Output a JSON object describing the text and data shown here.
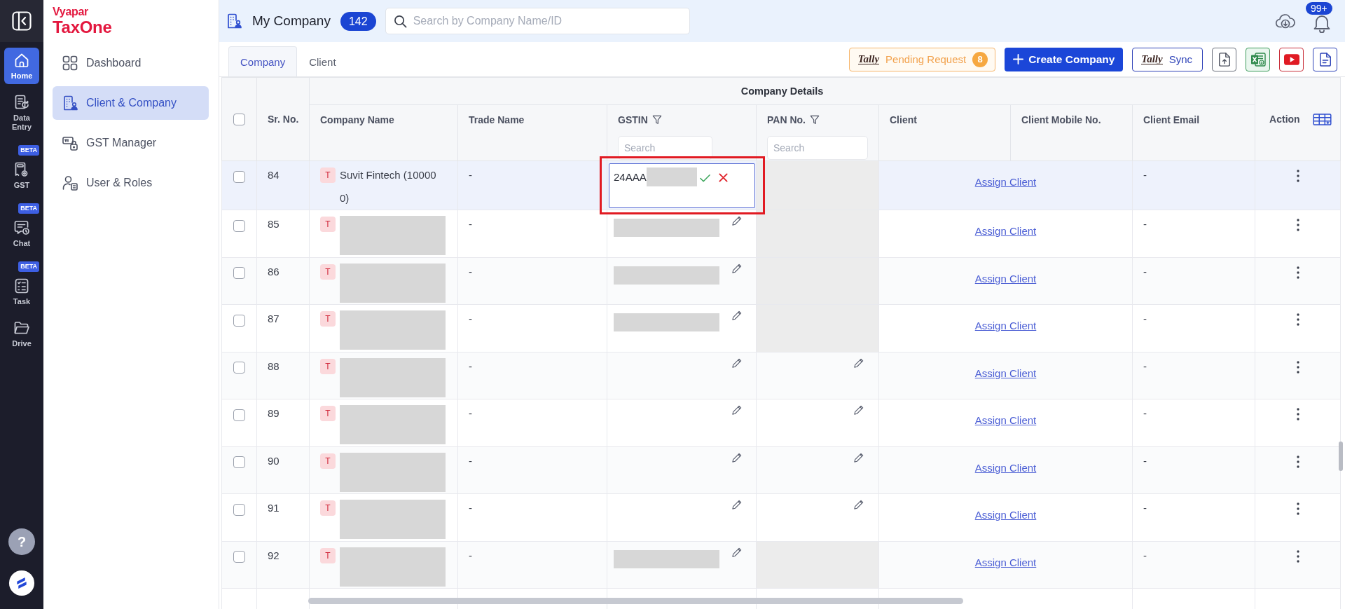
{
  "rail": {
    "items": [
      {
        "label": "Home",
        "selected": true
      },
      {
        "label": "Data Entry",
        "selected": false
      },
      {
        "label": "GST",
        "badge": "BETA",
        "selected": false
      },
      {
        "label": "Chat",
        "badge": "BETA",
        "selected": false
      },
      {
        "label": "Task",
        "badge": "BETA",
        "selected": false
      },
      {
        "label": "Drive",
        "selected": false
      }
    ],
    "help_label": "?"
  },
  "sidebar": {
    "logo": {
      "top": "Vyapar",
      "bottom": "TaxOne"
    },
    "items": [
      {
        "label": "Dashboard",
        "selected": false
      },
      {
        "label": "Client & Company",
        "selected": true
      },
      {
        "label": "GST Manager",
        "selected": false
      },
      {
        "label": "User & Roles",
        "selected": false
      }
    ]
  },
  "header": {
    "title": "My Company",
    "count": "142",
    "search": {
      "placeholder": "Search by Company Name/ID"
    },
    "notification_badge": "99+"
  },
  "tabs": [
    {
      "label": "Company",
      "selected": true
    },
    {
      "label": "Client",
      "selected": false
    }
  ],
  "toolbar": {
    "pending_request": {
      "logo": "Tally",
      "label": "Pending Request",
      "count": "8"
    },
    "create_button": {
      "label": "Create Company"
    },
    "sync_button": {
      "logo": "Tally",
      "label": "Sync"
    }
  },
  "table": {
    "all_checked": false,
    "group_header": "Company Details",
    "columns": [
      {
        "label": "Sr. No.",
        "kind": "fixed",
        "filterable": false
      },
      {
        "label": "Company Name",
        "kind": "grouped",
        "filterable": false
      },
      {
        "label": "Trade Name",
        "kind": "grouped",
        "filterable": false
      },
      {
        "label": "GSTIN",
        "kind": "grouped",
        "filterable": true,
        "search_placeholder": "Search"
      },
      {
        "label": "PAN No.",
        "kind": "grouped",
        "filterable": true,
        "search_placeholder": "Search"
      },
      {
        "label": "Client",
        "kind": "grouped",
        "filterable": false
      },
      {
        "label": "Client Mobile No.",
        "kind": "grouped",
        "filterable": false
      },
      {
        "label": "Client Email",
        "kind": "grouped",
        "filterable": false
      },
      {
        "label": "Action",
        "kind": "action",
        "filterable": false
      }
    ],
    "rows": [
      {
        "sr": "84",
        "avatar": "T",
        "company_name": "Suvit Fintech (100000)",
        "company_name_redacted": false,
        "trade_name": "-",
        "gstin": {
          "kind": "editing",
          "value": "24AAA",
          "redacted": true
        },
        "pan_locked": true,
        "client": "Assign Client",
        "client_email": "-",
        "checked": false,
        "selected": true,
        "highlighted": true
      },
      {
        "sr": "85",
        "avatar": "T",
        "company_name_redacted": true,
        "trade_name": "-",
        "gstin": {
          "kind": "display",
          "redacted": true
        },
        "pan_locked": true,
        "client": "Assign Client",
        "client_email": "-",
        "checked": false,
        "selected": false,
        "highlighted": false
      },
      {
        "sr": "86",
        "avatar": "T",
        "company_name_redacted": true,
        "trade_name": "-",
        "gstin": {
          "kind": "display",
          "redacted": true
        },
        "pan_locked": true,
        "client": "Assign Client",
        "client_email": "-",
        "checked": false,
        "selected": false,
        "highlighted": false
      },
      {
        "sr": "87",
        "avatar": "T",
        "company_name_redacted": true,
        "trade_name": "-",
        "gstin": {
          "kind": "display",
          "redacted": true
        },
        "pan_locked": true,
        "client": "Assign Client",
        "client_email": "-",
        "checked": false,
        "selected": false,
        "highlighted": false
      },
      {
        "sr": "88",
        "avatar": "T",
        "company_name_redacted": true,
        "trade_name": "-",
        "gstin": {
          "kind": "display",
          "redacted": false
        },
        "pan_locked": false,
        "client": "Assign Client",
        "client_email": "-",
        "checked": false,
        "selected": false,
        "highlighted": false
      },
      {
        "sr": "89",
        "avatar": "T",
        "company_name_redacted": true,
        "trade_name": "-",
        "gstin": {
          "kind": "display",
          "redacted": false
        },
        "pan_locked": false,
        "client": "Assign Client",
        "client_email": "-",
        "checked": false,
        "selected": false,
        "highlighted": false
      },
      {
        "sr": "90",
        "avatar": "T",
        "company_name_redacted": true,
        "trade_name": "-",
        "gstin": {
          "kind": "display",
          "redacted": false
        },
        "pan_locked": false,
        "client": "Assign Client",
        "client_email": "-",
        "checked": false,
        "selected": false,
        "highlighted": false
      },
      {
        "sr": "91",
        "avatar": "T",
        "company_name_redacted": true,
        "trade_name": "-",
        "gstin": {
          "kind": "display",
          "redacted": false
        },
        "pan_locked": false,
        "client": "Assign Client",
        "client_email": "-",
        "checked": false,
        "selected": false,
        "highlighted": false
      },
      {
        "sr": "92",
        "avatar": "T",
        "company_name_redacted": true,
        "trade_name": "-",
        "gstin": {
          "kind": "display",
          "redacted": true
        },
        "pan_locked": true,
        "client": "Assign Client",
        "client_email": "-",
        "checked": false,
        "selected": false,
        "highlighted": false
      }
    ]
  }
}
